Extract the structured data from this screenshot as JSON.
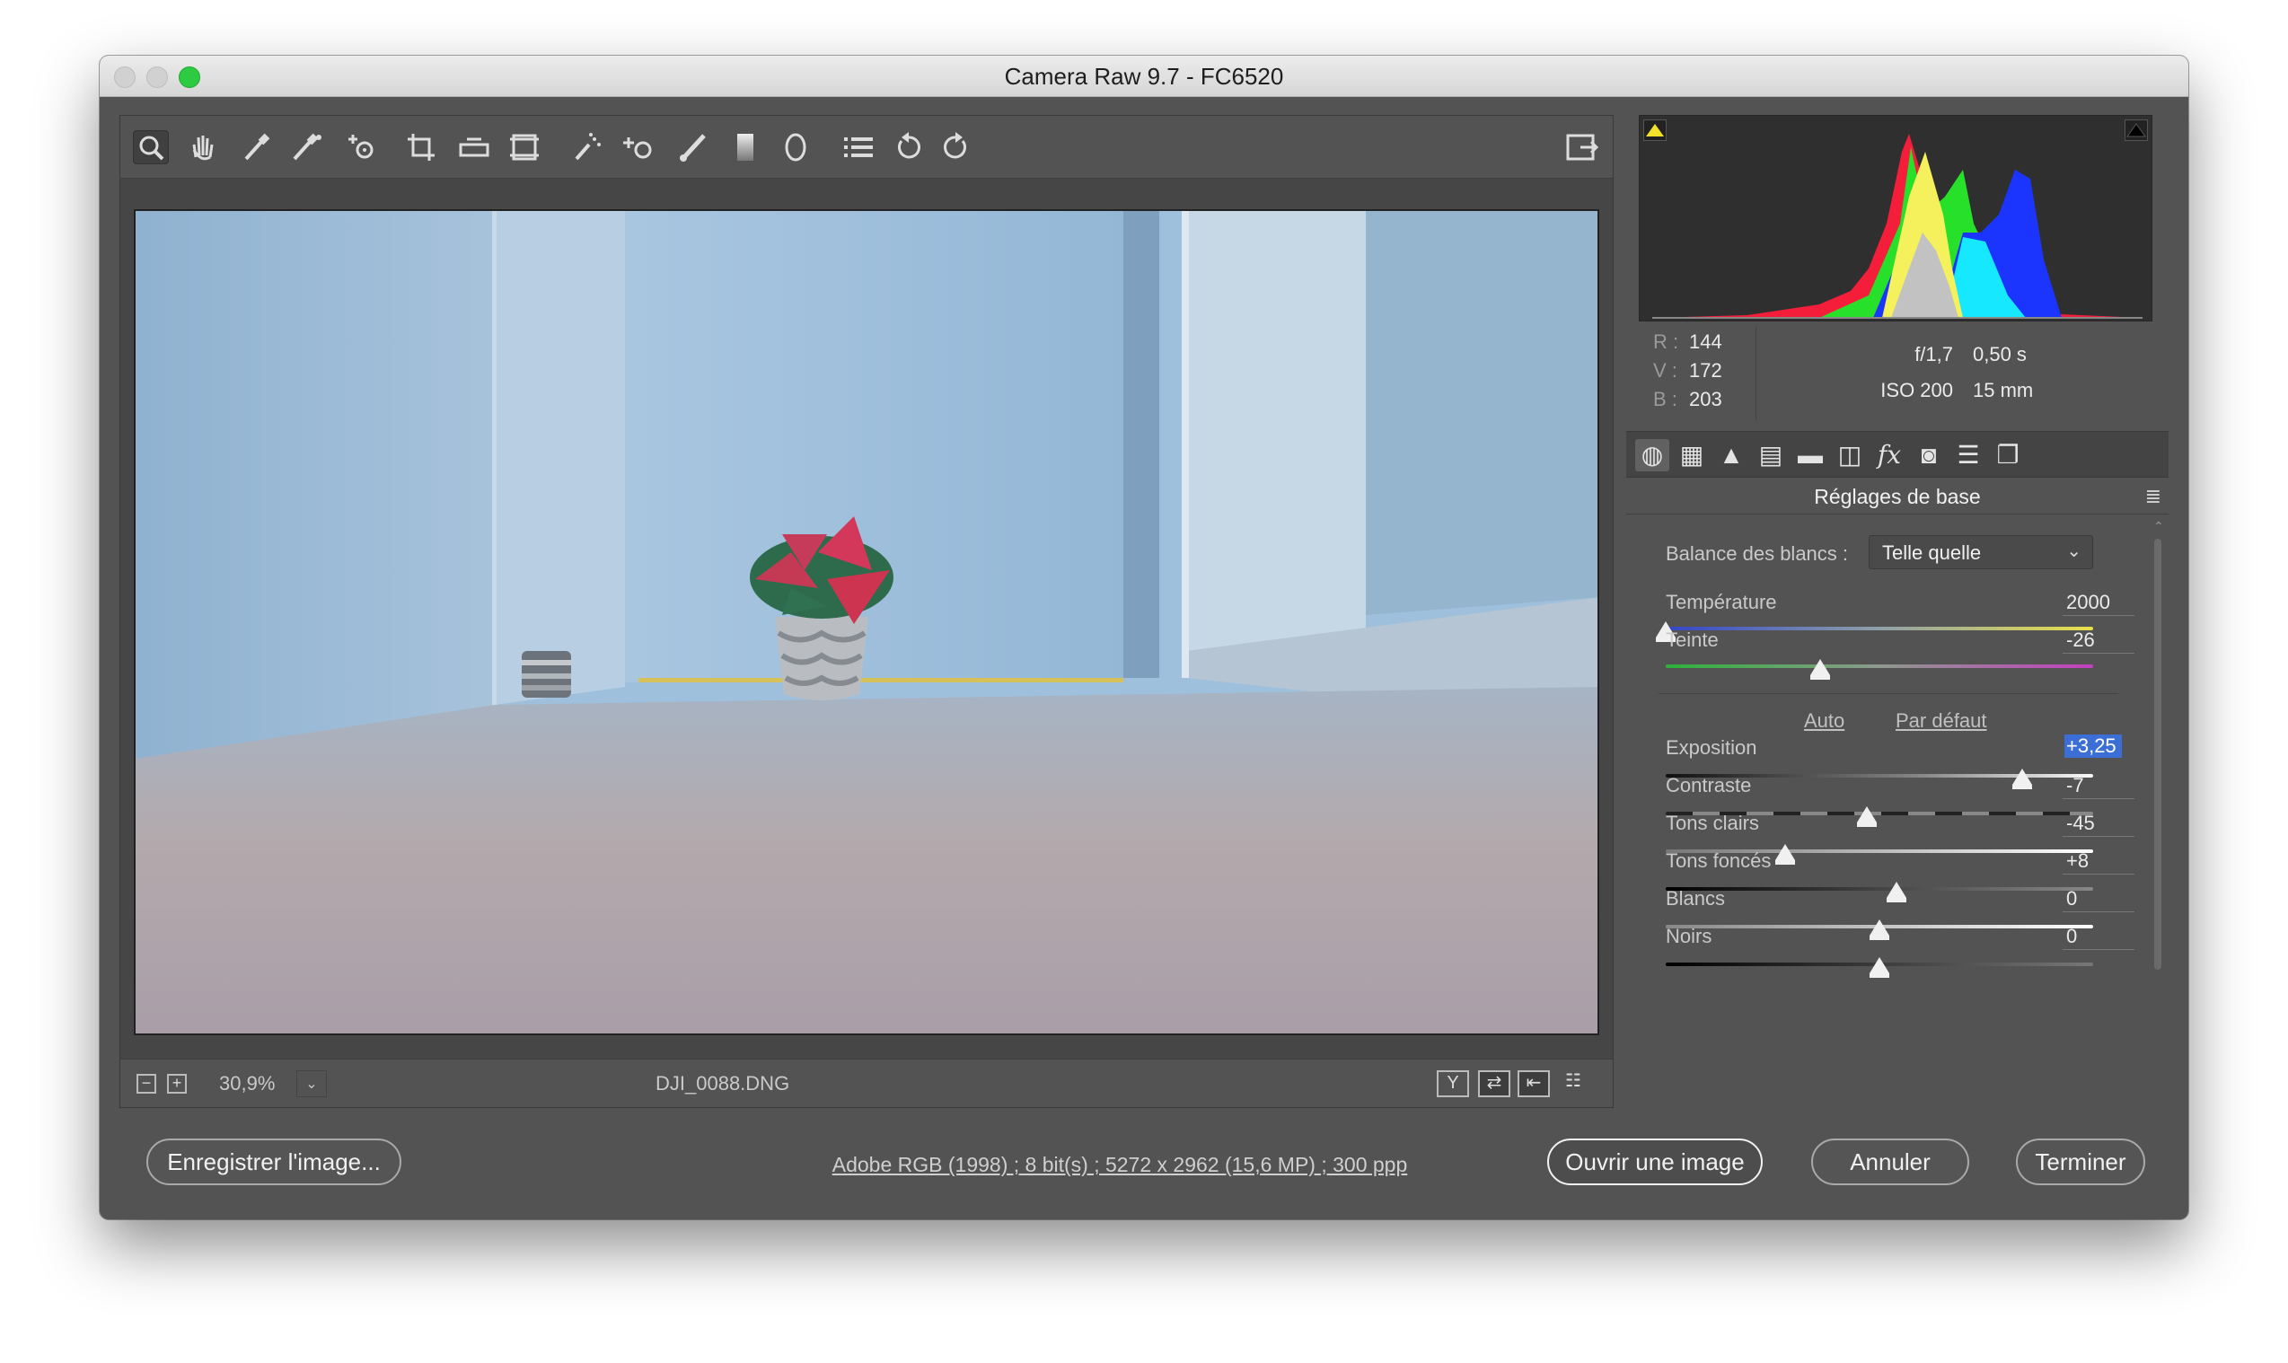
{
  "window": {
    "title": "Camera Raw 9.7  -  FC6520"
  },
  "toolbar": {
    "tools": [
      {
        "name": "zoom-tool-icon",
        "glyph": "🔍"
      },
      {
        "name": "hand-tool-icon",
        "glyph": "✋"
      },
      {
        "name": "white-balance-tool-icon",
        "glyph": "✎"
      },
      {
        "name": "color-sampler-tool-icon",
        "glyph": "✐"
      },
      {
        "name": "targeted-adjustment-tool-icon",
        "glyph": "⊕"
      },
      {
        "name": "crop-tool-icon",
        "glyph": "⌗"
      },
      {
        "name": "straighten-tool-icon",
        "glyph": "▭"
      },
      {
        "name": "transform-tool-icon",
        "glyph": "⊡"
      },
      {
        "name": "spot-removal-tool-icon",
        "glyph": "✧"
      },
      {
        "name": "red-eye-removal-icon",
        "glyph": "+◦"
      },
      {
        "name": "adjustment-brush-icon",
        "glyph": "⟋"
      },
      {
        "name": "graduated-filter-icon",
        "glyph": "▮"
      },
      {
        "name": "radial-filter-icon",
        "glyph": "◯"
      },
      {
        "name": "preferences-icon",
        "glyph": "☰"
      },
      {
        "name": "rotate-left-icon",
        "glyph": "↺"
      },
      {
        "name": "rotate-right-icon",
        "glyph": "↻"
      }
    ],
    "fullscreen_icon": "⇱"
  },
  "status": {
    "zoom": "30,9%",
    "filename": "DJI_0088.DNG"
  },
  "readout": {
    "r_label": "R :",
    "r": "144",
    "v_label": "V :",
    "v": "172",
    "b_label": "B :",
    "b": "203",
    "aperture": "f/1,7",
    "shutter": "0,50 s",
    "iso": "ISO 200",
    "focal": "15 mm"
  },
  "panel": {
    "title": "Réglages de base",
    "wb_label": "Balance des blancs :",
    "wb_value": "Telle quelle",
    "auto": "Auto",
    "default": "Par défaut",
    "sliders": [
      {
        "key": "temperature",
        "label": "Température",
        "value": "2000",
        "pos": 0.0
      },
      {
        "key": "tint",
        "label": "Teinte",
        "value": "-26",
        "pos": 0.37
      },
      {
        "key": "exposure",
        "label": "Exposition",
        "value": "+3,25",
        "pos": 0.83
      },
      {
        "key": "contrast",
        "label": "Contraste",
        "value": "-7",
        "pos": 0.47
      },
      {
        "key": "highlights",
        "label": "Tons clairs",
        "value": "-45",
        "pos": 0.28
      },
      {
        "key": "shadows",
        "label": "Tons foncés",
        "value": "+8",
        "pos": 0.54
      },
      {
        "key": "whites",
        "label": "Blancs",
        "value": "0",
        "pos": 0.5
      },
      {
        "key": "blacks",
        "label": "Noirs",
        "value": "0",
        "pos": 0.5
      }
    ]
  },
  "footer": {
    "save": "Enregistrer l'image...",
    "workflow": "Adobe RGB (1998) ; 8 bit(s) ; 5272 x 2962 (15,6 MP) ; 300 ppp",
    "open": "Ouvrir une image",
    "cancel": "Annuler",
    "done": "Terminer"
  },
  "colors": {
    "chrome": "#535353",
    "accent_selection": "#3c6fd6"
  }
}
